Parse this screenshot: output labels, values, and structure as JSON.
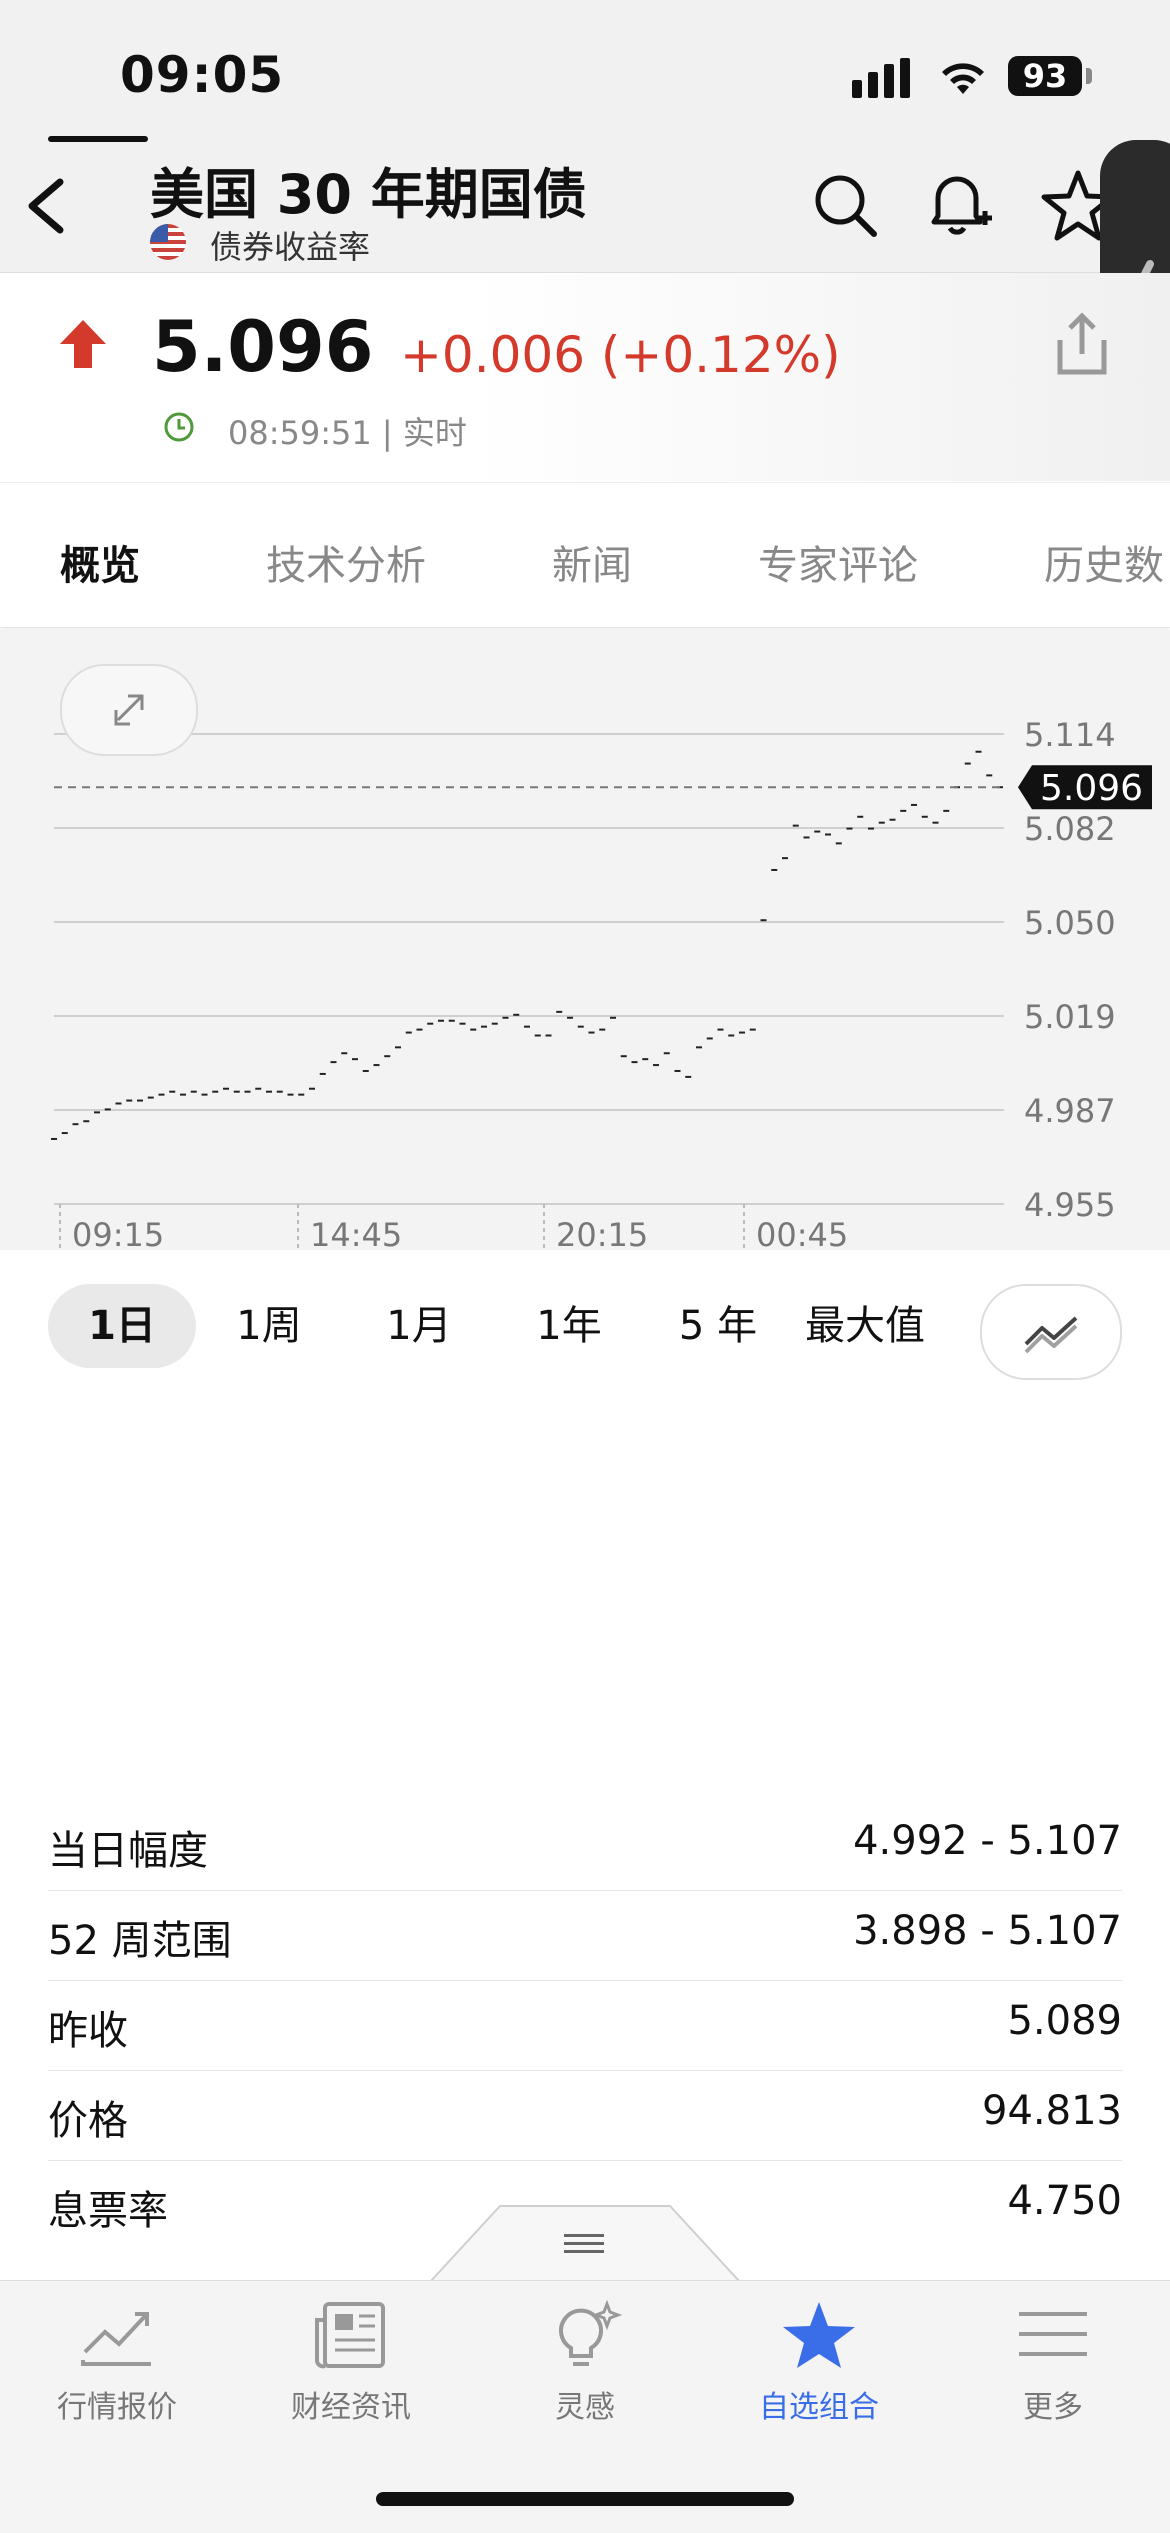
{
  "status_bar": {
    "time": "09:05",
    "battery": "93"
  },
  "header": {
    "title": "美国 30 年期国债",
    "subtitle": "债券收益率"
  },
  "quote": {
    "price": "5.096",
    "change": "+0.006 (+0.12%)",
    "time": "08:59:51 | 实时"
  },
  "tabs": [
    "概览",
    "技术分析",
    "新闻",
    "专家评论",
    "历史数"
  ],
  "periods": [
    "1日",
    "1周",
    "1月",
    "1年",
    "5 年",
    "最大值"
  ],
  "chart_data": {
    "type": "line",
    "y_ticks": [
      "5.114",
      "5.082",
      "5.050",
      "5.019",
      "4.987",
      "4.955"
    ],
    "ylim": [
      4.955,
      5.114
    ],
    "x_ticks": [
      "09:15",
      "14:45",
      "20:15",
      "00:45"
    ],
    "current_value": "5.096",
    "values": [
      4.977,
      4.979,
      4.982,
      4.983,
      4.986,
      4.987,
      4.989,
      4.99,
      4.99,
      4.991,
      4.992,
      4.993,
      4.992,
      4.993,
      4.992,
      4.993,
      4.994,
      4.993,
      4.993,
      4.994,
      4.993,
      4.993,
      4.992,
      4.992,
      4.994,
      4.999,
      5.003,
      5.006,
      5.004,
      5.0,
      5.002,
      5.005,
      5.008,
      5.013,
      5.014,
      5.016,
      5.017,
      5.017,
      5.016,
      5.014,
      5.015,
      5.016,
      5.018,
      5.019,
      5.015,
      5.012,
      5.012,
      5.02,
      5.018,
      5.015,
      5.013,
      5.014,
      5.018,
      5.005,
      5.003,
      5.004,
      5.002,
      5.006,
      5.0,
      4.998,
      5.008,
      5.011,
      5.014,
      5.012,
      5.013,
      5.014,
      5.051,
      5.068,
      5.072,
      5.083,
      5.079,
      5.081,
      5.08,
      5.077,
      5.082,
      5.086,
      5.082,
      5.084,
      5.085,
      5.088,
      5.09,
      5.086,
      5.084,
      5.088,
      5.096,
      5.104,
      5.108,
      5.1,
      5.096
    ]
  },
  "stats": [
    {
      "label": "当日幅度",
      "value": "4.992 - 5.107"
    },
    {
      "label": "52 周范围",
      "value": "3.898 - 5.107"
    },
    {
      "label": "昨收",
      "value": "5.089"
    },
    {
      "label": "价格",
      "value": "94.813"
    },
    {
      "label": "息票率",
      "value": "4.750"
    }
  ],
  "bottom_nav": [
    {
      "label": "行情报价",
      "icon": "chart-line-icon"
    },
    {
      "label": "财经资讯",
      "icon": "newspaper-icon"
    },
    {
      "label": "灵感",
      "icon": "lightbulb-icon"
    },
    {
      "label": "自选组合",
      "icon": "star-icon"
    },
    {
      "label": "更多",
      "icon": "menu-icon"
    }
  ],
  "colors": {
    "negative_red": "#d33a2c",
    "accent_blue": "#3a6ee8"
  }
}
